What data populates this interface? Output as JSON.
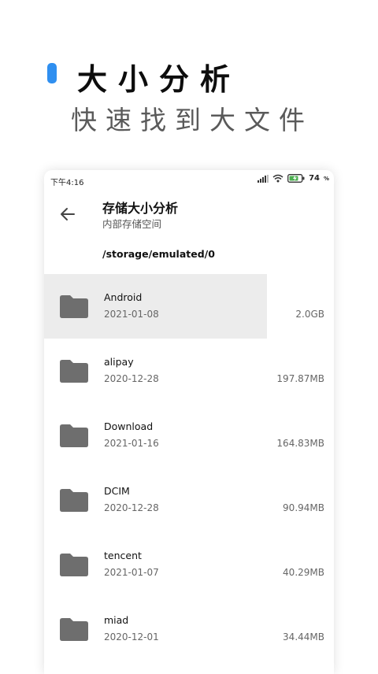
{
  "promo": {
    "title": "大小分析",
    "subtitle": "快速找到大文件",
    "accent_color": "#2f8ff0"
  },
  "status_bar": {
    "time": "下午4:16",
    "icons": [
      "signal-icon",
      "wifi-icon",
      "battery-charging-icon"
    ],
    "battery": "74"
  },
  "header": {
    "back_icon": "arrow-left-icon",
    "title": "存储大小分析",
    "subtitle": "内部存储空间"
  },
  "path": "/storage/emulated/0",
  "items": [
    {
      "name": "Android",
      "date": "2021-01-08",
      "size": "2.0GB",
      "selected": true
    },
    {
      "name": "alipay",
      "date": "2020-12-28",
      "size": "197.87MB"
    },
    {
      "name": "Download",
      "date": "2021-01-16",
      "size": "164.83MB"
    },
    {
      "name": "DCIM",
      "date": "2020-12-28",
      "size": "90.94MB"
    },
    {
      "name": "tencent",
      "date": "2021-01-07",
      "size": "40.29MB"
    },
    {
      "name": "miad",
      "date": "2020-12-01",
      "size": "34.44MB"
    }
  ]
}
